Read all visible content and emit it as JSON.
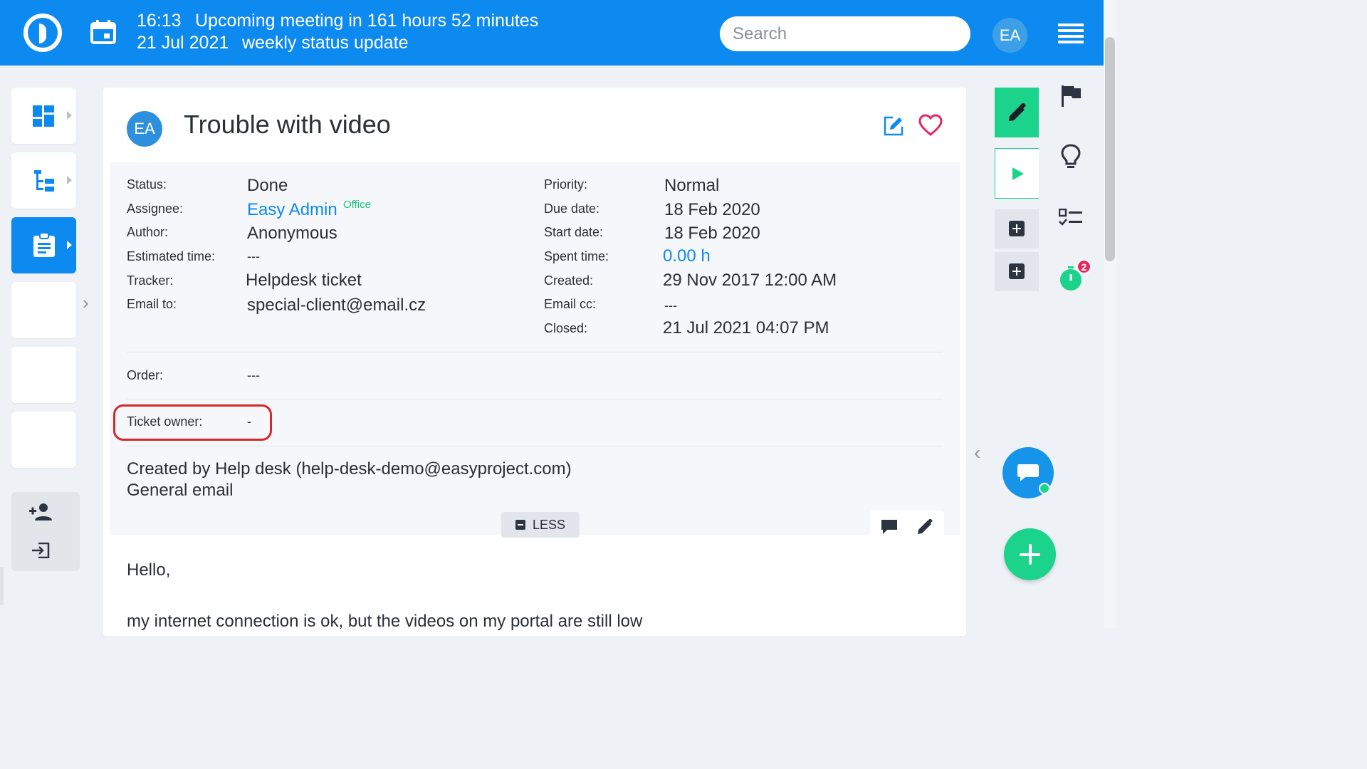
{
  "topbar": {
    "meeting_time": "16:13",
    "meeting_text": "Upcoming meeting in 161 hours 52 minutes",
    "meeting_date": "21 Jul 2021",
    "meeting_title": "weekly status update",
    "search_placeholder": "Search",
    "user_initials": "EA"
  },
  "issue": {
    "avatar_initials": "EA",
    "title": "Trouble with video"
  },
  "attributes_left": [
    {
      "label": "Status:",
      "value": "Done"
    },
    {
      "label": "Assignee:",
      "value": "Easy Admin",
      "tag": "Office"
    },
    {
      "label": "Author:",
      "value": "Anonymous"
    },
    {
      "label": "Estimated time:",
      "value": "---"
    },
    {
      "label": "Tracker:",
      "value": "Helpdesk ticket"
    },
    {
      "label": "Email to:",
      "value": "special-client@email.cz"
    }
  ],
  "attributes_right": [
    {
      "label": "Priority:",
      "value": "Normal"
    },
    {
      "label": "Due date:",
      "value": "18 Feb 2020"
    },
    {
      "label": "Start date:",
      "value": "18 Feb 2020"
    },
    {
      "label": "Spent time:",
      "value": "0.00 h"
    },
    {
      "label": "Created:",
      "value": "29 Nov 2017 12:00 AM"
    },
    {
      "label": "Email cc:",
      "value": "---"
    },
    {
      "label": "Closed:",
      "value": "21 Jul 2021 04:07 PM"
    }
  ],
  "custom_fields": {
    "order_label": "Order:",
    "order_value": "---",
    "ticket_owner_label": "Ticket owner:",
    "ticket_owner_value": "-"
  },
  "description": {
    "line1": "Created by Help desk (help-desk-demo@easyproject.com)",
    "line2": "General email",
    "less_label": "LESS",
    "body_greeting": "Hello,",
    "body_line": "my internet connection is ok, but the videos on my portal are still low"
  },
  "right_panel": {
    "notification_count": "2"
  },
  "colors": {
    "brand_blue": "#0d8af0",
    "accent_green": "#1cd38b",
    "badge_red": "#e8265e",
    "highlight_red": "#d62828"
  }
}
